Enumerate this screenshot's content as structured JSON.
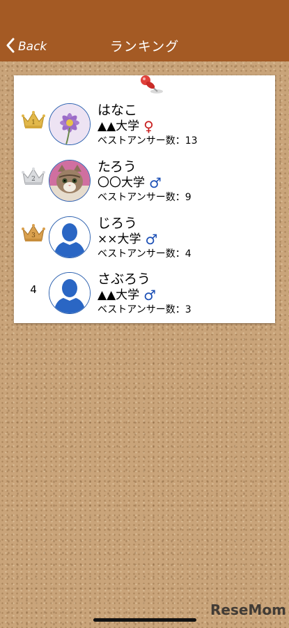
{
  "header": {
    "back_label": "Back",
    "title": "ランキング"
  },
  "colors": {
    "header_bg": "#a45a24",
    "gold": "#e2b84a",
    "silver": "#c7c9cc",
    "bronze": "#d9a04e",
    "female": "#c81e1e",
    "male": "#1b4fb5"
  },
  "ranking": [
    {
      "rank": "1",
      "badge": "gold-crown-icon",
      "avatar": "cosmos-flower-photo",
      "name": "はなこ",
      "university": "▲▲大学",
      "gender_symbol": "♀",
      "best_answers": "ベストアンサー数：13"
    },
    {
      "rank": "2",
      "badge": "silver-crown-icon",
      "avatar": "cat-photo",
      "name": "たろう",
      "university": "〇〇大学",
      "gender_symbol": "♂",
      "best_answers": "ベストアンサー数：9"
    },
    {
      "rank": "3",
      "badge": "bronze-crown-icon",
      "avatar": "default-user-silhouette",
      "name": "じろう",
      "university": "××大学",
      "gender_symbol": "♂",
      "best_answers": "ベストアンサー数：4"
    },
    {
      "rank": "4",
      "badge": "",
      "avatar": "default-user-silhouette",
      "name": "さぶろう",
      "university": "▲▲大学",
      "gender_symbol": "♂",
      "best_answers": "ベストアンサー数：3"
    }
  ],
  "watermark": "ReseMom"
}
